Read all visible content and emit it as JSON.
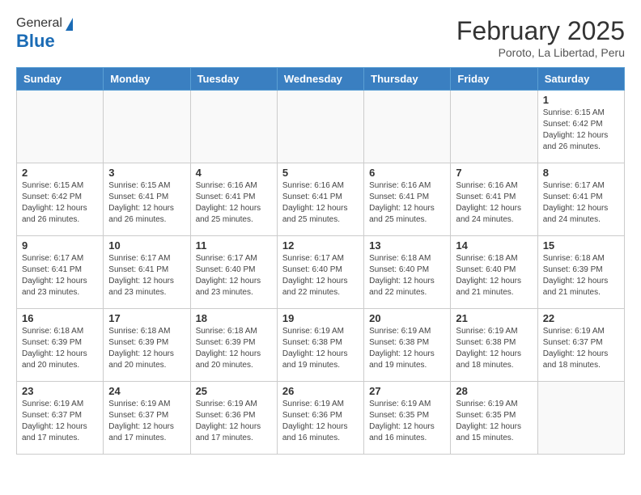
{
  "header": {
    "logo": {
      "line1": "General",
      "line2": "Blue"
    },
    "title": "February 2025",
    "subtitle": "Poroto, La Libertad, Peru"
  },
  "days_of_week": [
    "Sunday",
    "Monday",
    "Tuesday",
    "Wednesday",
    "Thursday",
    "Friday",
    "Saturday"
  ],
  "weeks": [
    {
      "days": [
        {
          "number": "",
          "info": ""
        },
        {
          "number": "",
          "info": ""
        },
        {
          "number": "",
          "info": ""
        },
        {
          "number": "",
          "info": ""
        },
        {
          "number": "",
          "info": ""
        },
        {
          "number": "",
          "info": ""
        },
        {
          "number": "1",
          "info": "Sunrise: 6:15 AM\nSunset: 6:42 PM\nDaylight: 12 hours and 26 minutes."
        }
      ]
    },
    {
      "days": [
        {
          "number": "2",
          "info": "Sunrise: 6:15 AM\nSunset: 6:42 PM\nDaylight: 12 hours and 26 minutes."
        },
        {
          "number": "3",
          "info": "Sunrise: 6:15 AM\nSunset: 6:41 PM\nDaylight: 12 hours and 26 minutes."
        },
        {
          "number": "4",
          "info": "Sunrise: 6:16 AM\nSunset: 6:41 PM\nDaylight: 12 hours and 25 minutes."
        },
        {
          "number": "5",
          "info": "Sunrise: 6:16 AM\nSunset: 6:41 PM\nDaylight: 12 hours and 25 minutes."
        },
        {
          "number": "6",
          "info": "Sunrise: 6:16 AM\nSunset: 6:41 PM\nDaylight: 12 hours and 25 minutes."
        },
        {
          "number": "7",
          "info": "Sunrise: 6:16 AM\nSunset: 6:41 PM\nDaylight: 12 hours and 24 minutes."
        },
        {
          "number": "8",
          "info": "Sunrise: 6:17 AM\nSunset: 6:41 PM\nDaylight: 12 hours and 24 minutes."
        }
      ]
    },
    {
      "days": [
        {
          "number": "9",
          "info": "Sunrise: 6:17 AM\nSunset: 6:41 PM\nDaylight: 12 hours and 23 minutes."
        },
        {
          "number": "10",
          "info": "Sunrise: 6:17 AM\nSunset: 6:41 PM\nDaylight: 12 hours and 23 minutes."
        },
        {
          "number": "11",
          "info": "Sunrise: 6:17 AM\nSunset: 6:40 PM\nDaylight: 12 hours and 23 minutes."
        },
        {
          "number": "12",
          "info": "Sunrise: 6:17 AM\nSunset: 6:40 PM\nDaylight: 12 hours and 22 minutes."
        },
        {
          "number": "13",
          "info": "Sunrise: 6:18 AM\nSunset: 6:40 PM\nDaylight: 12 hours and 22 minutes."
        },
        {
          "number": "14",
          "info": "Sunrise: 6:18 AM\nSunset: 6:40 PM\nDaylight: 12 hours and 21 minutes."
        },
        {
          "number": "15",
          "info": "Sunrise: 6:18 AM\nSunset: 6:39 PM\nDaylight: 12 hours and 21 minutes."
        }
      ]
    },
    {
      "days": [
        {
          "number": "16",
          "info": "Sunrise: 6:18 AM\nSunset: 6:39 PM\nDaylight: 12 hours and 20 minutes."
        },
        {
          "number": "17",
          "info": "Sunrise: 6:18 AM\nSunset: 6:39 PM\nDaylight: 12 hours and 20 minutes."
        },
        {
          "number": "18",
          "info": "Sunrise: 6:18 AM\nSunset: 6:39 PM\nDaylight: 12 hours and 20 minutes."
        },
        {
          "number": "19",
          "info": "Sunrise: 6:19 AM\nSunset: 6:38 PM\nDaylight: 12 hours and 19 minutes."
        },
        {
          "number": "20",
          "info": "Sunrise: 6:19 AM\nSunset: 6:38 PM\nDaylight: 12 hours and 19 minutes."
        },
        {
          "number": "21",
          "info": "Sunrise: 6:19 AM\nSunset: 6:38 PM\nDaylight: 12 hours and 18 minutes."
        },
        {
          "number": "22",
          "info": "Sunrise: 6:19 AM\nSunset: 6:37 PM\nDaylight: 12 hours and 18 minutes."
        }
      ]
    },
    {
      "days": [
        {
          "number": "23",
          "info": "Sunrise: 6:19 AM\nSunset: 6:37 PM\nDaylight: 12 hours and 17 minutes."
        },
        {
          "number": "24",
          "info": "Sunrise: 6:19 AM\nSunset: 6:37 PM\nDaylight: 12 hours and 17 minutes."
        },
        {
          "number": "25",
          "info": "Sunrise: 6:19 AM\nSunset: 6:36 PM\nDaylight: 12 hours and 17 minutes."
        },
        {
          "number": "26",
          "info": "Sunrise: 6:19 AM\nSunset: 6:36 PM\nDaylight: 12 hours and 16 minutes."
        },
        {
          "number": "27",
          "info": "Sunrise: 6:19 AM\nSunset: 6:35 PM\nDaylight: 12 hours and 16 minutes."
        },
        {
          "number": "28",
          "info": "Sunrise: 6:19 AM\nSunset: 6:35 PM\nDaylight: 12 hours and 15 minutes."
        },
        {
          "number": "",
          "info": ""
        }
      ]
    }
  ]
}
